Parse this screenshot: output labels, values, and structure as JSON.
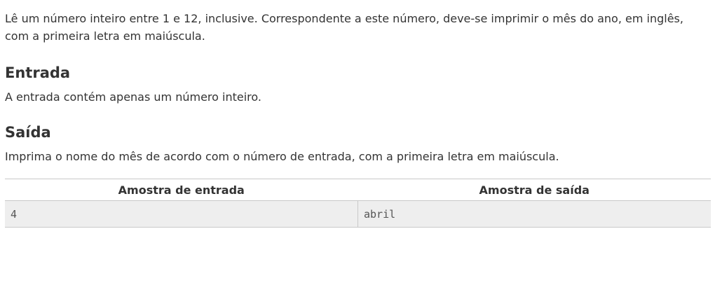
{
  "description": "Lê um número inteiro entre 1 e 12, inclusive. Correspondente a este número, deve-se imprimir o mês do ano, em inglês, com a primeira letra em maiúscula.",
  "input_section": {
    "title": "Entrada",
    "text": "A entrada contém apenas um número inteiro."
  },
  "output_section": {
    "title": "Saída",
    "text": "Imprima o nome do mês de acordo com o número de entrada, com a primeira letra em maiúscula."
  },
  "samples": {
    "input_header": "Amostra de entrada",
    "output_header": "Amostra de saída",
    "rows": [
      {
        "input": "4",
        "output": "abril"
      }
    ]
  }
}
